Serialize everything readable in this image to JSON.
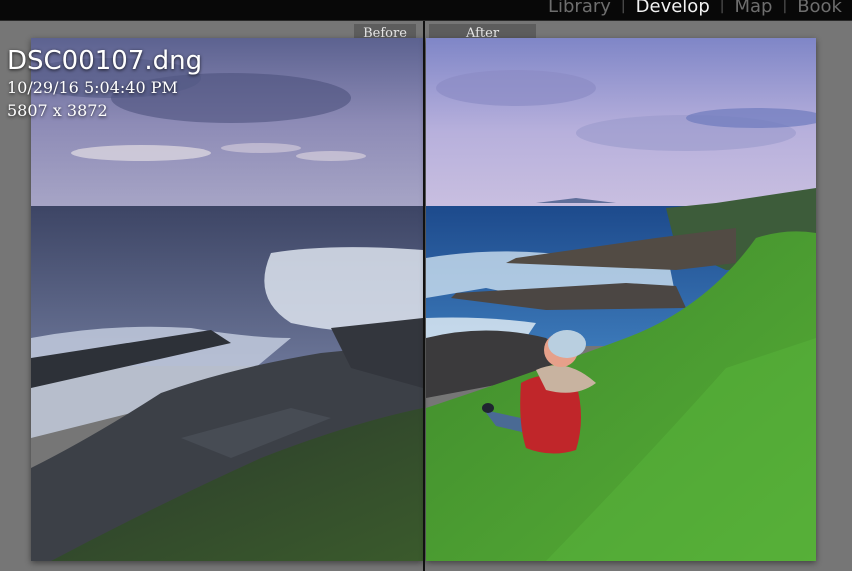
{
  "modules": {
    "library": "Library",
    "develop": "Develop",
    "map": "Map",
    "book": "Book"
  },
  "view": {
    "before_label": "Before",
    "after_label": "After"
  },
  "photo_info": {
    "filename": "DSC00107.dng",
    "datetime": "10/29/16 5:04:40 PM",
    "dimensions": "5807 x 3872"
  },
  "colors": {
    "topbar": "#080808",
    "background": "#767676",
    "active_module": "#f2f2f2",
    "inactive_module": "#6e6e6e",
    "jacket": "#c0262a",
    "grass": "#3e9a2e"
  }
}
